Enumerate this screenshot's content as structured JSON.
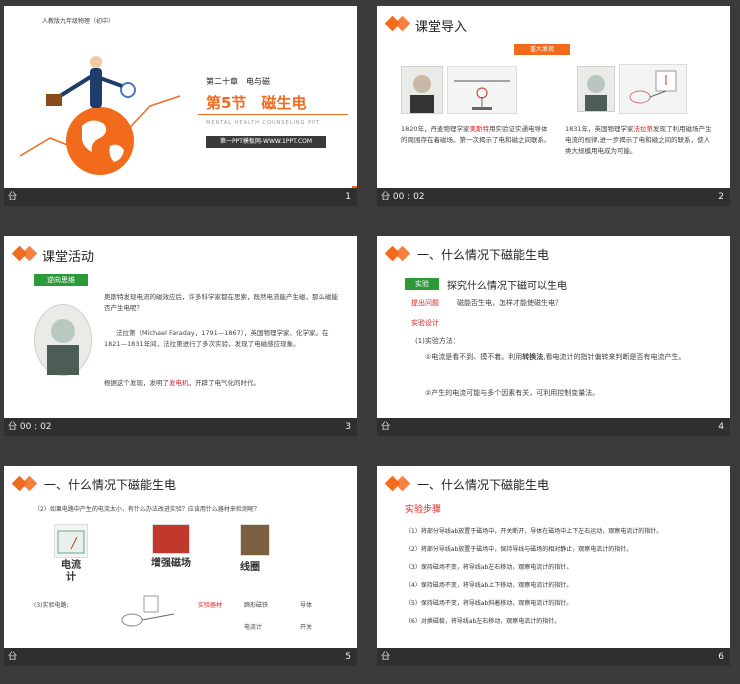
{
  "slides": [
    {
      "num": "1",
      "publisher": "人教版九年级物理（初中）",
      "chapter": "第二十章　电与磁",
      "section_title": "第5节　磁生电",
      "subtitle_en": "MENTAL HEALTH COUNSELING PPT",
      "website": "第一PPT模板网-WWW.1PPT.COM",
      "footer_left": "㕣"
    },
    {
      "num": "2",
      "title": "课堂导入",
      "badge": "重大发现",
      "footer_left": "㕣 00 : 02",
      "text_left_pre": "1820年，丹麦物理学家",
      "text_left_red": "奥斯特",
      "text_left_post": "用实验证实通电导体的周围存在着磁场。第一次揭示了电和磁之间联系。",
      "text_right_pre": "1831年，英国物理学家",
      "text_right_red": "法拉第",
      "text_right_post": "发现了利用磁场产生电流的规律,进一步揭示了电和磁之间的联系，使人类大规模用电成为可能。"
    },
    {
      "num": "3",
      "title": "课堂活动",
      "tag": "逆向思维",
      "footer_left": "㕣 00 : 02",
      "para1": "奥斯特发现电流的磁效应后，许多科学家都在思索，既然电流能产生磁，那么磁能否产生电呢？",
      "para2": "法拉第（Michael Faraday，1791—1867），英国物理学家、化学家。在1821—1831年间，法拉第进行了多次实验，发现了电磁感应现象。",
      "para3_pre": "根据这个发现，发明了",
      "para3_red": "发电机",
      "para3_post": "，开辟了电气化的时代。"
    },
    {
      "num": "4",
      "heading": "一、什么情况下磁能生电",
      "exp_tag": "实验",
      "exp_title": "探究什么情况下磁可以生电",
      "question_label": "提出问题",
      "question": "磁能否生电，怎样才能使磁生电？",
      "design_label": "实验设计",
      "method": "(1)实验方法：",
      "item1_pre": "①电流是看不到、摸不着。利用",
      "item1_bold": "转换法",
      "item1_post": ",看电流计的指针偏转来判断是否有电流产生。",
      "item2": "②产生的电流可能与多个因素有关，可利用控制变量法。",
      "footer_left": "㕣"
    },
    {
      "num": "5",
      "heading": "一、什么情况下磁能生电",
      "question": "（2）如果电路中产生的电流太小，有什么办法改进实验？应该用什么器材来检测呢？",
      "label_galvanometer": "电流计",
      "label_magnet": "增强磁场",
      "label_coil": "线圈",
      "circuit_label": "(3)实验电路:",
      "equip_label": "实验器材",
      "equip_1": "蹄形磁铁",
      "equip_2": "导体",
      "equip_3": "电流计",
      "equip_4": "开关",
      "footer_left": "㕣"
    },
    {
      "num": "6",
      "heading": "一、什么情况下磁能生电",
      "steps_label": "实验步骤",
      "steps": [
        "（1）将部分导线ab放置于磁场中，开关断开，导体在磁场中上下左右运动，观察电流计的指针。",
        "（2）将部分导线ab放置于磁场中，保持导线与磁场的相对静止，观察电流计的指针。",
        "（3）保持磁场不变，将导线ab左右移动，观察电流计的指针。",
        "（4）保持磁场不变，将导线ab上下移动，观察电流计的指针。",
        "（5）保持磁场不变，将导线ab斜着移动，观察电流计的指针。",
        "（6）对换磁极，将导线ab左右移动，观察电流计的指针。"
      ],
      "footer_left": "㕣"
    }
  ],
  "colors": {
    "accent": "#f26b1d",
    "green": "#2d9a3a",
    "red": "#e02020",
    "bg": "#3b3b3b"
  }
}
